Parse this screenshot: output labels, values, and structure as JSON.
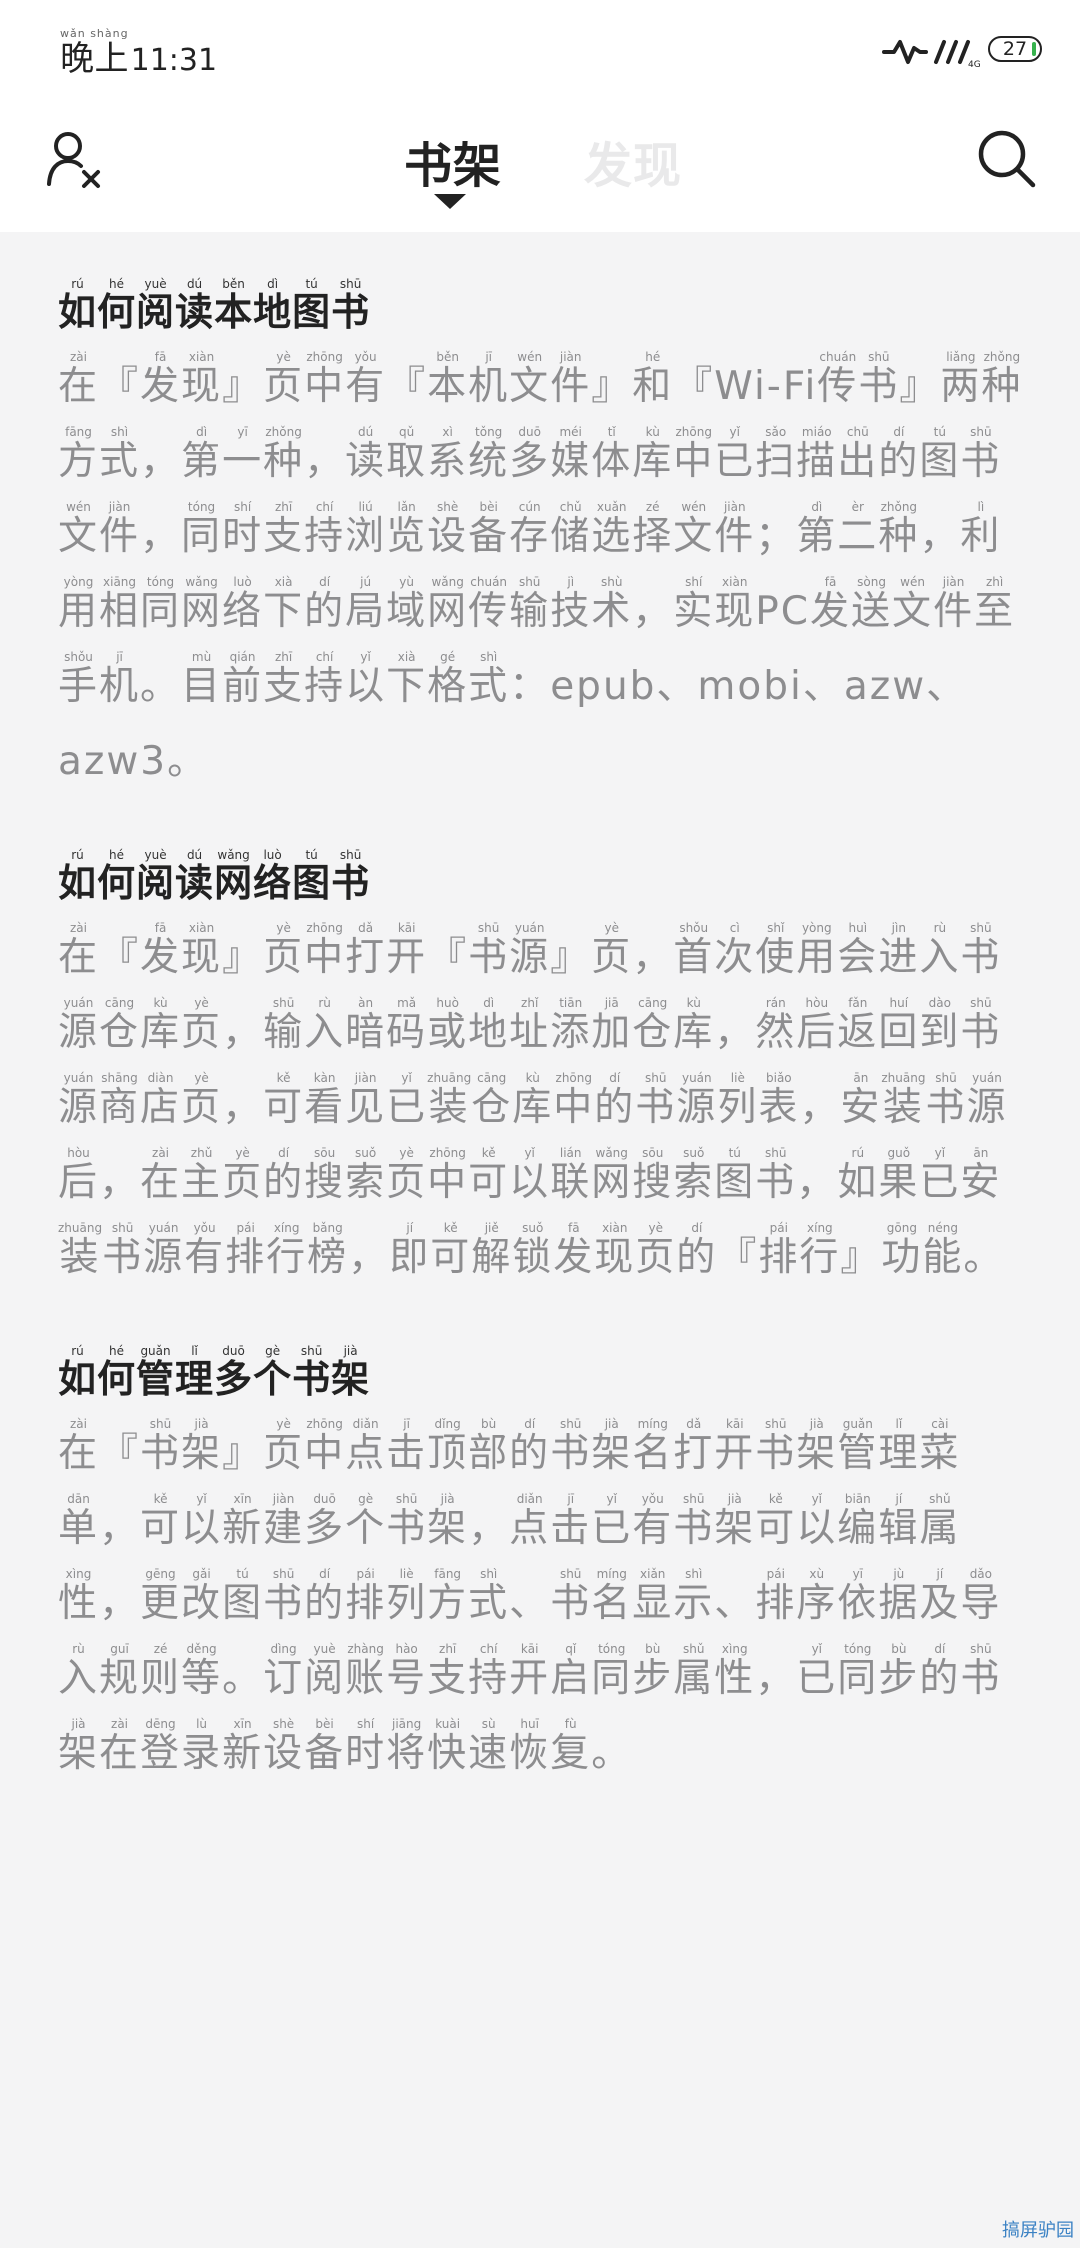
{
  "status_bar": {
    "period": {
      "text": "晚上",
      "pinyin": "wǎn shàng"
    },
    "time": "11:31",
    "battery": "27"
  },
  "header": {
    "tabs": [
      {
        "label": "书架",
        "active": true
      },
      {
        "label": "发现",
        "active": false
      }
    ],
    "icons": {
      "left": "user-x-icon",
      "right": "search-icon"
    }
  },
  "sections": [
    {
      "title": [
        [
          "如",
          "rú"
        ],
        [
          "何",
          "hé"
        ],
        [
          "阅",
          "yuè"
        ],
        [
          "读",
          "dú"
        ],
        [
          "本",
          "běn"
        ],
        [
          "地",
          "dì"
        ],
        [
          "图",
          "tú"
        ],
        [
          "书",
          "shū"
        ]
      ],
      "body": [
        [
          "在",
          "zài"
        ],
        [
          "『",
          ""
        ],
        [
          "发",
          "fā"
        ],
        [
          "现",
          "xiàn"
        ],
        [
          "』",
          ""
        ],
        [
          "页",
          "yè"
        ],
        [
          "中",
          "zhōng"
        ],
        [
          "有",
          "yǒu"
        ],
        [
          "『",
          ""
        ],
        [
          "本",
          "běn"
        ],
        [
          "机",
          "jī"
        ],
        [
          "文",
          "wén"
        ],
        [
          "件",
          "jiàn"
        ],
        [
          "』",
          ""
        ],
        [
          "和",
          "hé"
        ],
        [
          "『",
          ""
        ],
        [
          "Wi-Fi",
          ""
        ],
        [
          "传",
          "chuán"
        ],
        [
          "书",
          "shū"
        ],
        [
          "』",
          ""
        ],
        [
          "两",
          "liǎng"
        ],
        [
          "种",
          "zhǒng"
        ],
        [
          "方",
          "fāng"
        ],
        [
          "式",
          "shì"
        ],
        [
          "，",
          ""
        ],
        [
          "第",
          "dì"
        ],
        [
          "一",
          "yī"
        ],
        [
          "种",
          "zhǒng"
        ],
        [
          "，",
          ""
        ],
        [
          "读",
          "dú"
        ],
        [
          "取",
          "qǔ"
        ],
        [
          "系",
          "xì"
        ],
        [
          "统",
          "tǒng"
        ],
        [
          "多",
          "duō"
        ],
        [
          "媒",
          "méi"
        ],
        [
          "体",
          "tǐ"
        ],
        [
          "库",
          "kù"
        ],
        [
          "中",
          "zhōng"
        ],
        [
          "已",
          "yǐ"
        ],
        [
          "扫",
          "sǎo"
        ],
        [
          "描",
          "miáo"
        ],
        [
          "出",
          "chū"
        ],
        [
          "的",
          "dí"
        ],
        [
          "图",
          "tú"
        ],
        [
          "书",
          "shū"
        ],
        [
          "文",
          "wén"
        ],
        [
          "件",
          "jiàn"
        ],
        [
          "，",
          ""
        ],
        [
          "同",
          "tóng"
        ],
        [
          "时",
          "shí"
        ],
        [
          "支",
          "zhī"
        ],
        [
          "持",
          "chí"
        ],
        [
          "浏",
          "liú"
        ],
        [
          "览",
          "lǎn"
        ],
        [
          "设",
          "shè"
        ],
        [
          "备",
          "bèi"
        ],
        [
          "存",
          "cún"
        ],
        [
          "储",
          "chǔ"
        ],
        [
          "选",
          "xuǎn"
        ],
        [
          "择",
          "zé"
        ],
        [
          "文",
          "wén"
        ],
        [
          "件",
          "jiàn"
        ],
        [
          "；",
          ""
        ],
        [
          "第",
          "dì"
        ],
        [
          "二",
          "èr"
        ],
        [
          "种",
          "zhǒng"
        ],
        [
          "，",
          ""
        ],
        [
          "利",
          "lì"
        ],
        [
          "用",
          "yòng"
        ],
        [
          "相",
          "xiāng"
        ],
        [
          "同",
          "tóng"
        ],
        [
          "网",
          "wǎng"
        ],
        [
          "络",
          "luò"
        ],
        [
          "下",
          "xià"
        ],
        [
          "的",
          "dí"
        ],
        [
          "局",
          "jú"
        ],
        [
          "域",
          "yù"
        ],
        [
          "网",
          "wǎng"
        ],
        [
          "传",
          "chuán"
        ],
        [
          "输",
          "shū"
        ],
        [
          "技",
          "jì"
        ],
        [
          "术",
          "shù"
        ],
        [
          "，",
          ""
        ],
        [
          "实",
          "shí"
        ],
        [
          "现",
          "xiàn"
        ],
        [
          "PC",
          ""
        ],
        [
          "发",
          "fā"
        ],
        [
          "送",
          "sòng"
        ],
        [
          "文",
          "wén"
        ],
        [
          "件",
          "jiàn"
        ],
        [
          "至",
          "zhì"
        ],
        [
          "手",
          "shǒu"
        ],
        [
          "机",
          "jī"
        ],
        [
          "。",
          ""
        ],
        [
          "目",
          "mù"
        ],
        [
          "前",
          "qián"
        ],
        [
          "支",
          "zhī"
        ],
        [
          "持",
          "chí"
        ],
        [
          "以",
          "yǐ"
        ],
        [
          "下",
          "xià"
        ],
        [
          "格",
          "gé"
        ],
        [
          "式",
          "shì"
        ],
        [
          "：",
          ""
        ],
        [
          "epub、mobi、azw、azw3。",
          ""
        ]
      ]
    },
    {
      "title": [
        [
          "如",
          "rú"
        ],
        [
          "何",
          "hé"
        ],
        [
          "阅",
          "yuè"
        ],
        [
          "读",
          "dú"
        ],
        [
          "网",
          "wǎng"
        ],
        [
          "络",
          "luò"
        ],
        [
          "图",
          "tú"
        ],
        [
          "书",
          "shū"
        ]
      ],
      "body": [
        [
          "在",
          "zài"
        ],
        [
          "『",
          ""
        ],
        [
          "发",
          "fā"
        ],
        [
          "现",
          "xiàn"
        ],
        [
          "』",
          ""
        ],
        [
          "页",
          "yè"
        ],
        [
          "中",
          "zhōng"
        ],
        [
          "打",
          "dǎ"
        ],
        [
          "开",
          "kāi"
        ],
        [
          "『",
          ""
        ],
        [
          "书",
          "shū"
        ],
        [
          "源",
          "yuán"
        ],
        [
          "』",
          ""
        ],
        [
          "页",
          "yè"
        ],
        [
          "，",
          ""
        ],
        [
          "首",
          "shǒu"
        ],
        [
          "次",
          "cì"
        ],
        [
          "使",
          "shǐ"
        ],
        [
          "用",
          "yòng"
        ],
        [
          "会",
          "huì"
        ],
        [
          "进",
          "jìn"
        ],
        [
          "入",
          "rù"
        ],
        [
          "书",
          "shū"
        ],
        [
          "源",
          "yuán"
        ],
        [
          "仓",
          "cāng"
        ],
        [
          "库",
          "kù"
        ],
        [
          "页",
          "yè"
        ],
        [
          "，",
          ""
        ],
        [
          "输",
          "shū"
        ],
        [
          "入",
          "rù"
        ],
        [
          "暗",
          "àn"
        ],
        [
          "码",
          "mǎ"
        ],
        [
          "或",
          "huò"
        ],
        [
          "地",
          "dì"
        ],
        [
          "址",
          "zhǐ"
        ],
        [
          "添",
          "tiān"
        ],
        [
          "加",
          "jiā"
        ],
        [
          "仓",
          "cāng"
        ],
        [
          "库",
          "kù"
        ],
        [
          "，",
          ""
        ],
        [
          "然",
          "rán"
        ],
        [
          "后",
          "hòu"
        ],
        [
          "返",
          "fǎn"
        ],
        [
          "回",
          "huí"
        ],
        [
          "到",
          "dào"
        ],
        [
          "书",
          "shū"
        ],
        [
          "源",
          "yuán"
        ],
        [
          "商",
          "shāng"
        ],
        [
          "店",
          "diàn"
        ],
        [
          "页",
          "yè"
        ],
        [
          "，",
          ""
        ],
        [
          "可",
          "kě"
        ],
        [
          "看",
          "kàn"
        ],
        [
          "见",
          "jiàn"
        ],
        [
          "已",
          "yǐ"
        ],
        [
          "装",
          "zhuāng"
        ],
        [
          "仓",
          "cāng"
        ],
        [
          "库",
          "kù"
        ],
        [
          "中",
          "zhōng"
        ],
        [
          "的",
          "dí"
        ],
        [
          "书",
          "shū"
        ],
        [
          "源",
          "yuán"
        ],
        [
          "列",
          "liè"
        ],
        [
          "表",
          "biǎo"
        ],
        [
          "，",
          ""
        ],
        [
          "安",
          "ān"
        ],
        [
          "装",
          "zhuāng"
        ],
        [
          "书",
          "shū"
        ],
        [
          "源",
          "yuán"
        ],
        [
          "后",
          "hòu"
        ],
        [
          "，",
          ""
        ],
        [
          "在",
          "zài"
        ],
        [
          "主",
          "zhǔ"
        ],
        [
          "页",
          "yè"
        ],
        [
          "的",
          "dí"
        ],
        [
          "搜",
          "sōu"
        ],
        [
          "索",
          "suǒ"
        ],
        [
          "页",
          "yè"
        ],
        [
          "中",
          "zhōng"
        ],
        [
          "可",
          "kě"
        ],
        [
          "以",
          "yǐ"
        ],
        [
          "联",
          "lián"
        ],
        [
          "网",
          "wǎng"
        ],
        [
          "搜",
          "sōu"
        ],
        [
          "索",
          "suǒ"
        ],
        [
          "图",
          "tú"
        ],
        [
          "书",
          "shū"
        ],
        [
          "，",
          ""
        ],
        [
          "如",
          "rú"
        ],
        [
          "果",
          "guǒ"
        ],
        [
          "已",
          "yǐ"
        ],
        [
          "安",
          "ān"
        ],
        [
          "装",
          "zhuāng"
        ],
        [
          "书",
          "shū"
        ],
        [
          "源",
          "yuán"
        ],
        [
          "有",
          "yǒu"
        ],
        [
          "排",
          "pái"
        ],
        [
          "行",
          "xíng"
        ],
        [
          "榜",
          "bǎng"
        ],
        [
          "，",
          ""
        ],
        [
          "即",
          "jí"
        ],
        [
          "可",
          "kě"
        ],
        [
          "解",
          "jiě"
        ],
        [
          "锁",
          "suǒ"
        ],
        [
          "发",
          "fā"
        ],
        [
          "现",
          "xiàn"
        ],
        [
          "页",
          "yè"
        ],
        [
          "的",
          "dí"
        ],
        [
          "『",
          ""
        ],
        [
          "排",
          "pái"
        ],
        [
          "行",
          "xíng"
        ],
        [
          "』",
          ""
        ],
        [
          "功",
          "gōng"
        ],
        [
          "能",
          "néng"
        ],
        [
          "。",
          ""
        ]
      ]
    },
    {
      "title": [
        [
          "如",
          "rú"
        ],
        [
          "何",
          "hé"
        ],
        [
          "管",
          "guǎn"
        ],
        [
          "理",
          "lǐ"
        ],
        [
          "多",
          "duō"
        ],
        [
          "个",
          "gè"
        ],
        [
          "书",
          "shū"
        ],
        [
          "架",
          "jià"
        ]
      ],
      "body": [
        [
          "在",
          "zài"
        ],
        [
          "『",
          ""
        ],
        [
          "书",
          "shū"
        ],
        [
          "架",
          "jià"
        ],
        [
          "』",
          ""
        ],
        [
          "页",
          "yè"
        ],
        [
          "中",
          "zhōng"
        ],
        [
          "点",
          "diǎn"
        ],
        [
          "击",
          "jī"
        ],
        [
          "顶",
          "dǐng"
        ],
        [
          "部",
          "bù"
        ],
        [
          "的",
          "dí"
        ],
        [
          "书",
          "shū"
        ],
        [
          "架",
          "jià"
        ],
        [
          "名",
          "míng"
        ],
        [
          "打",
          "dǎ"
        ],
        [
          "开",
          "kāi"
        ],
        [
          "书",
          "shū"
        ],
        [
          "架",
          "jià"
        ],
        [
          "管",
          "guǎn"
        ],
        [
          "理",
          "lǐ"
        ],
        [
          "菜",
          "cài"
        ],
        [
          "单",
          "dān"
        ],
        [
          "，",
          ""
        ],
        [
          "可",
          "kě"
        ],
        [
          "以",
          "yǐ"
        ],
        [
          "新",
          "xīn"
        ],
        [
          "建",
          "jiàn"
        ],
        [
          "多",
          "duō"
        ],
        [
          "个",
          "gè"
        ],
        [
          "书",
          "shū"
        ],
        [
          "架",
          "jià"
        ],
        [
          "，",
          ""
        ],
        [
          "点",
          "diǎn"
        ],
        [
          "击",
          "jī"
        ],
        [
          "已",
          "yǐ"
        ],
        [
          "有",
          "yǒu"
        ],
        [
          "书",
          "shū"
        ],
        [
          "架",
          "jià"
        ],
        [
          "可",
          "kě"
        ],
        [
          "以",
          "yǐ"
        ],
        [
          "编",
          "biān"
        ],
        [
          "辑",
          "jí"
        ],
        [
          "属",
          "shǔ"
        ],
        [
          "性",
          "xìng"
        ],
        [
          "，",
          ""
        ],
        [
          "更",
          "gēng"
        ],
        [
          "改",
          "gǎi"
        ],
        [
          "图",
          "tú"
        ],
        [
          "书",
          "shū"
        ],
        [
          "的",
          "dí"
        ],
        [
          "排",
          "pái"
        ],
        [
          "列",
          "liè"
        ],
        [
          "方",
          "fāng"
        ],
        [
          "式",
          "shì"
        ],
        [
          "、",
          ""
        ],
        [
          "书",
          "shū"
        ],
        [
          "名",
          "míng"
        ],
        [
          "显",
          "xiǎn"
        ],
        [
          "示",
          "shì"
        ],
        [
          "、",
          ""
        ],
        [
          "排",
          "pái"
        ],
        [
          "序",
          "xù"
        ],
        [
          "依",
          "yī"
        ],
        [
          "据",
          "jù"
        ],
        [
          "及",
          "jí"
        ],
        [
          "导",
          "dǎo"
        ],
        [
          "入",
          "rù"
        ],
        [
          "规",
          "guī"
        ],
        [
          "则",
          "zé"
        ],
        [
          "等",
          "děng"
        ],
        [
          "。",
          ""
        ],
        [
          "订",
          "dìng"
        ],
        [
          "阅",
          "yuè"
        ],
        [
          "账",
          "zhàng"
        ],
        [
          "号",
          "hào"
        ],
        [
          "支",
          "zhī"
        ],
        [
          "持",
          "chí"
        ],
        [
          "开",
          "kāi"
        ],
        [
          "启",
          "qǐ"
        ],
        [
          "同",
          "tóng"
        ],
        [
          "步",
          "bù"
        ],
        [
          "属",
          "shǔ"
        ],
        [
          "性",
          "xìng"
        ],
        [
          "，",
          ""
        ],
        [
          "已",
          "yǐ"
        ],
        [
          "同",
          "tóng"
        ],
        [
          "步",
          "bù"
        ],
        [
          "的",
          "dí"
        ],
        [
          "书",
          "shū"
        ],
        [
          "架",
          "jià"
        ],
        [
          "在",
          "zài"
        ],
        [
          "登",
          "dēng"
        ],
        [
          "录",
          "lù"
        ],
        [
          "新",
          "xīn"
        ],
        [
          "设",
          "shè"
        ],
        [
          "备",
          "bèi"
        ],
        [
          "时",
          "shí"
        ],
        [
          "将",
          "jiāng"
        ],
        [
          "快",
          "kuài"
        ],
        [
          "速",
          "sù"
        ],
        [
          "恢",
          "huī"
        ],
        [
          "复",
          "fù"
        ],
        [
          "。",
          ""
        ]
      ]
    }
  ],
  "watermark": "搞屏驴园"
}
